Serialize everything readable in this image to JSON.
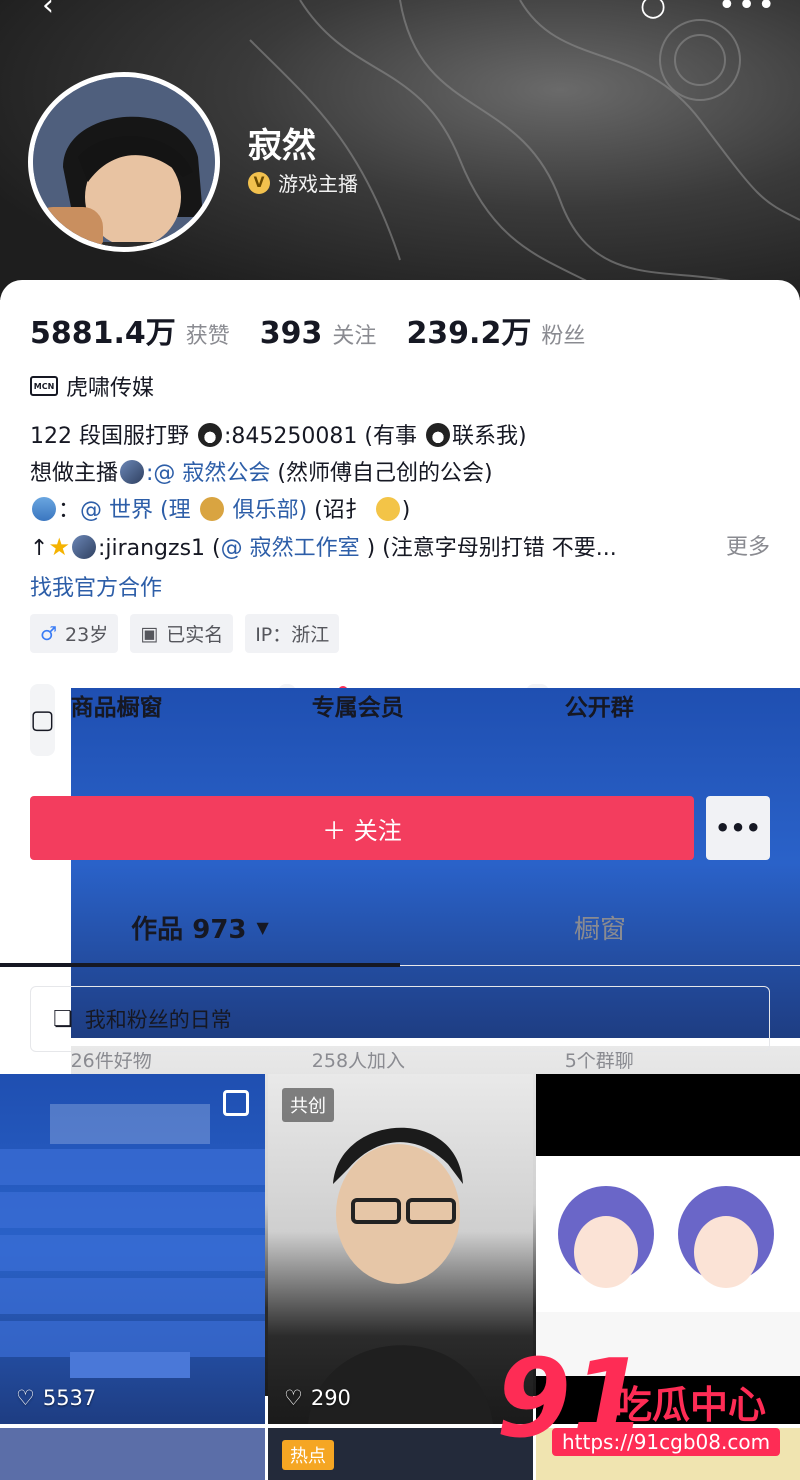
{
  "profile": {
    "name": "寂然",
    "verify_label": "游戏主播",
    "verify_badge": "V"
  },
  "stats": [
    {
      "num": "5881.4万",
      "label": "获赞"
    },
    {
      "num": "393",
      "label": "关注"
    },
    {
      "num": "239.2万",
      "label": "粉丝"
    }
  ],
  "mcn": {
    "badge": "MCN",
    "name": "虎啸传媒"
  },
  "bio": {
    "line1_a": "122 段国服打野 ",
    "line1_b": ":845250081 (有事 ",
    "line1_c": "联系我)",
    "line2_a": "想做主播",
    "line2_link": ":@ 寂然公会",
    "line2_b": " (然师傅自己创的公会)",
    "line3_a": "：",
    "line3_link": "@ 世界 (理 ",
    "line3_link2": " 俱乐部)",
    "line3_b": " (诏扌 ",
    "line3_c": ")",
    "line4_a": "↑",
    "line4_b": ":jirangzs1 (",
    "line4_link": "@ 寂然工作室",
    "line4_c": " ) (注意字母别打错 不要...",
    "more": "更多"
  },
  "official_link": "找我官方合作",
  "tags": [
    {
      "icon": "♂",
      "text": "23岁"
    },
    {
      "icon": "▣",
      "text": "已实名"
    },
    {
      "icon": "",
      "text": "IP：浙江"
    }
  ],
  "features": [
    {
      "title": "商品橱窗",
      "sub": "26件好物",
      "icon": "▢"
    },
    {
      "title": "专属会员",
      "sub": "258人加入",
      "icon": "V"
    },
    {
      "title": "公开群",
      "sub": "5个群聊",
      "icon": "◎"
    }
  ],
  "follow_label": "＋ 关注",
  "more_label": "•••",
  "tabs": {
    "works": "作品 973",
    "caret": "▼",
    "window": "橱窗"
  },
  "collection_label": "我和粉丝的日常",
  "videos": [
    {
      "likes": "5537"
    },
    {
      "likes": "290",
      "badge": "共创"
    },
    {
      "likes": ""
    },
    {
      "likes": ""
    },
    {
      "likes": "",
      "badge": "热点"
    },
    {
      "likes": ""
    }
  ],
  "watermark": {
    "num": "91",
    "text": "吃瓜中心",
    "url": "https://91cgb08.com"
  },
  "colors": {
    "accent": "#fe2c55",
    "follow_button": "#f33d5e",
    "link": "#2d5ea8"
  }
}
